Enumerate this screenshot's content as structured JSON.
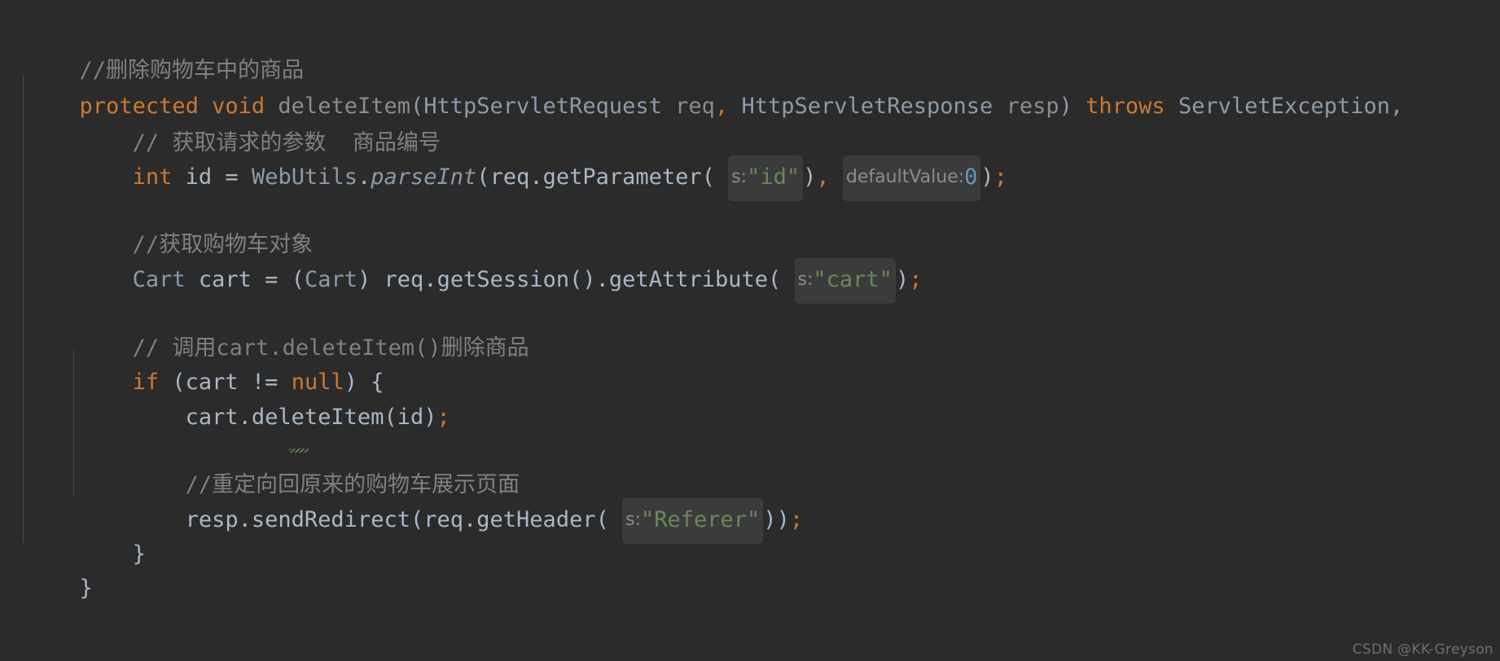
{
  "editor": {
    "theme_name": "darcula",
    "background_color": "#2b2b2b",
    "language": "java",
    "colors": {
      "keyword": "#cc7832",
      "string": "#6a8759",
      "number": "#6897bb",
      "comment": "#808080",
      "identifier": "#a9b7c6",
      "type": "#8c9aab",
      "method_declaration": "#8c8c8c",
      "hint_background": "#3b3b3b",
      "hint_text": "#8c8c8c",
      "indent_guide": "#4b4b4b"
    }
  },
  "code": {
    "line1": {
      "comment": "//删除购物车中的商品"
    },
    "line2": {
      "kw_protected": "protected",
      "kw_void": "void",
      "method_name": "deleteItem",
      "paren_open": "(",
      "type_request": "HttpServletRequest",
      "param_req": "req",
      "comma1": ",",
      "type_response": "HttpServletResponse",
      "param_resp": "resp",
      "paren_close": ")",
      "kw_throws": "throws",
      "type_exception": "ServletException",
      "comma2": ","
    },
    "line3": {
      "comment": "// 获取请求的参数  商品编号"
    },
    "line4": {
      "kw_int": "int",
      "var_id": "id",
      "equals": "=",
      "class_webutils": "WebUtils",
      "dot1": ".",
      "method_parseint": "parseInt",
      "paren_open": "(",
      "obj_req": "req",
      "dot2": ".",
      "method_getparameter": "getParameter",
      "paren_open2": "(",
      "hint_s": "s:",
      "str_id": "\"id\"",
      "paren_close2": ")",
      "comma": ",",
      "hint_defaultvalue": "defaultValue:",
      "num_zero": "0",
      "paren_close": ")",
      "semicolon": ";"
    },
    "line5": {
      "comment": "//获取购物车对象"
    },
    "line6": {
      "type_cart": "Cart",
      "var_cart": "cart",
      "equals": "=",
      "cast_open": "(",
      "cast_type": "Cart",
      "cast_close": ")",
      "obj_req": "req",
      "dot1": ".",
      "method_getsession": "getSession",
      "parens1": "()",
      "dot2": ".",
      "method_getattribute": "getAttribute",
      "paren_open": "(",
      "hint_s": "s:",
      "str_cart": "\"cart\"",
      "paren_close": ")",
      "semicolon": ";"
    },
    "line7": {
      "comment": "// 调用cart.deleteItem()删除商品"
    },
    "line8": {
      "kw_if": "if",
      "paren_open": "(",
      "var_cart": "cart",
      "op_ne": "!=",
      "kw_null": "null",
      "paren_close": ")",
      "brace_open": "{"
    },
    "line9": {
      "obj_cart": "cart",
      "dot": ".",
      "method_deleteitem": "deleteItem",
      "paren_open": "(",
      "arg_id": "id",
      "paren_close": ")",
      "semicolon": ";"
    },
    "line10": {
      "comment": "//重定向回原来的购物车展示页面"
    },
    "line11": {
      "obj_resp": "resp",
      "dot1": ".",
      "method_sendredirect": "sendRedirect",
      "paren_open": "(",
      "obj_req": "req",
      "dot2": ".",
      "method_getheader": "getHeader",
      "paren_open2": "(",
      "hint_s": "s:",
      "str_referer": "\"Referer\"",
      "paren_close2": ")",
      "paren_close": ")",
      "semicolon": ";"
    },
    "line12": {
      "brace_close": "}"
    },
    "line13": {
      "brace_close": "}"
    }
  },
  "watermark": {
    "text": "CSDN @KK-Greyson"
  }
}
